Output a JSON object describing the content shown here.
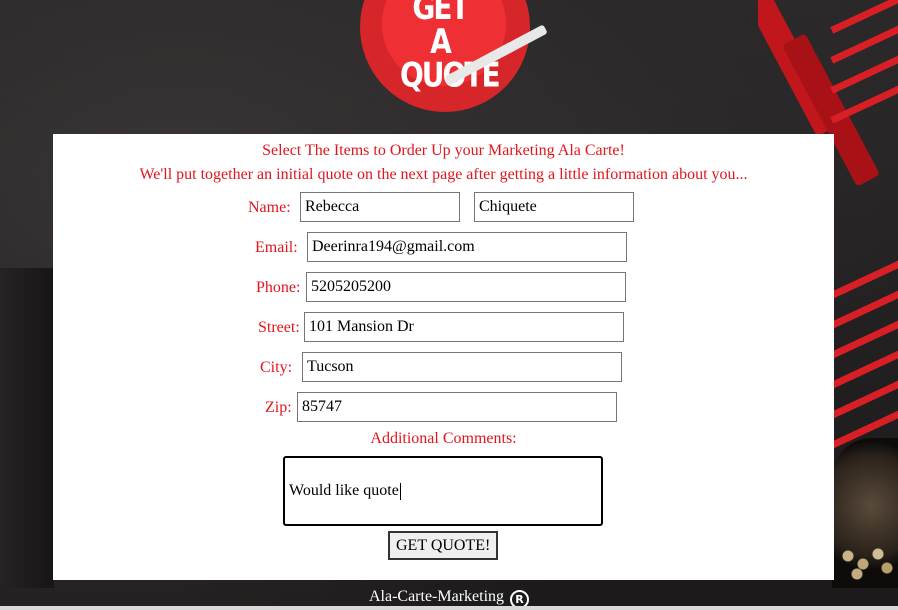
{
  "logo": {
    "text_line1": "GET A",
    "text_line2": "QUOTE"
  },
  "intro": {
    "line1": "Select The Items to Order Up your Marketing Ala Carte!",
    "line2": "We'll put together an initial quote on the next page after getting a little information about you..."
  },
  "form": {
    "name_label": "Name:",
    "first_name": "Rebecca",
    "last_name": "Chiquete",
    "email_label": "Email:",
    "email": "Deerinra194@gmail.com",
    "phone_label": "Phone:",
    "phone": "5205205200",
    "street_label": "Street:",
    "street": "101 Mansion Dr",
    "city_label": "City:",
    "city": "Tucson",
    "zip_label": "Zip:",
    "zip": "85747",
    "comments_label": "Additional Comments:",
    "comments": "Would like quote",
    "submit_label": "GET QUOTE!"
  },
  "footer": {
    "text": "Ala-Carte-Marketing",
    "reg_symbol": "R"
  },
  "colors": {
    "accent_red": "#e0161c",
    "logo_red": "#d7262a",
    "panel_bg": "#ffffff"
  }
}
